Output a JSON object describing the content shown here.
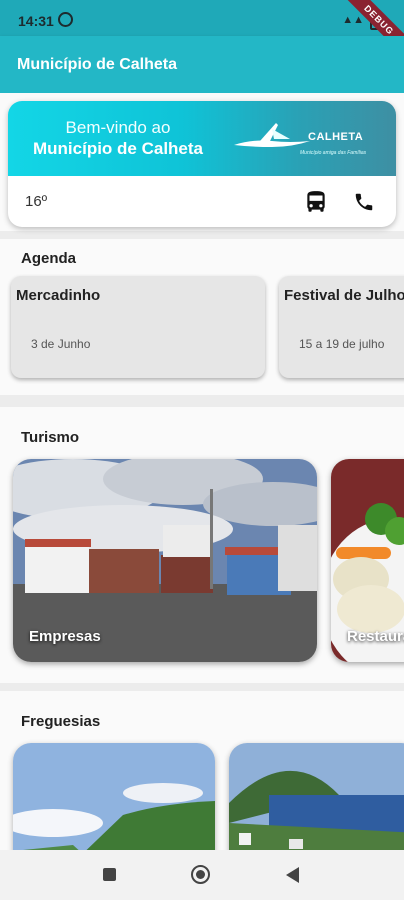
{
  "status_bar": {
    "time": "14:31",
    "debug_label": "DEBUG"
  },
  "app_bar": {
    "title": "Município de Calheta"
  },
  "welcome": {
    "line1": "Bem-vindo ao",
    "line2": "Município de Calheta",
    "logo_brand": "CALHETA",
    "logo_tagline": "Município amiga das Famílias",
    "temperature": "16º",
    "bus_icon": "bus-icon",
    "phone_icon": "phone-icon"
  },
  "agenda": {
    "title": "Agenda",
    "events": [
      {
        "name": "Mercadinho",
        "date": "3 de Junho"
      },
      {
        "name": "Festival de Julho",
        "date": "15 a 19 de julho"
      }
    ]
  },
  "turismo": {
    "title": "Turismo",
    "cards": [
      {
        "label": "Empresas"
      },
      {
        "label": "Restaurantes"
      }
    ]
  },
  "freguesias": {
    "title": "Freguesias"
  },
  "colors": {
    "appbar": "#23b7c6",
    "statusbar": "#1fa9b8",
    "debug": "#8a2331"
  }
}
